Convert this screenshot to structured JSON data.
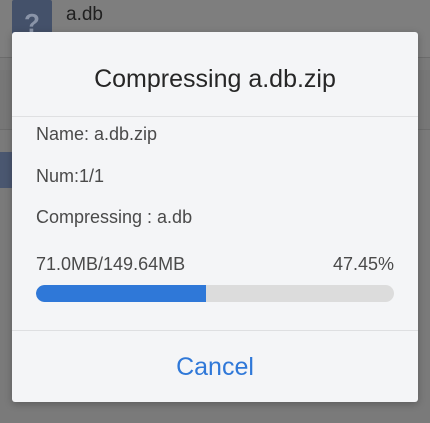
{
  "background": {
    "file_name": "a.db",
    "file_icon_glyph": "?"
  },
  "dialog": {
    "title": "Compressing a.db.zip",
    "name_line": "Name: a.db.zip",
    "num_line": "Num:1/1",
    "current_line": "Compressing : a.db",
    "progress_text": "71.0MB/149.64MB",
    "progress_percent_label": "47.45%",
    "progress_fraction": 0.4745,
    "cancel_label": "Cancel"
  },
  "colors": {
    "accent": "#2f78d8",
    "track": "#dcdcdc",
    "dialog_bg": "#f4f5f7"
  },
  "icons": {
    "background_file_icon": "unknown-file-icon"
  }
}
